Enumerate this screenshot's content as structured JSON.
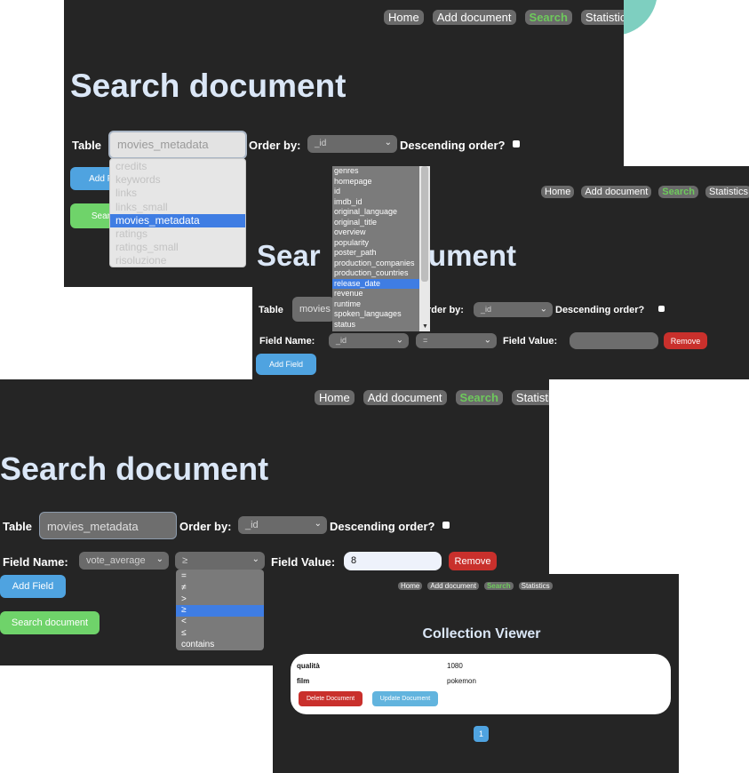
{
  "nav": {
    "home": "Home",
    "add": "Add document",
    "search": "Search",
    "stats": "Statistics"
  },
  "search": {
    "title": "Search document",
    "table_label": "Table",
    "order_label": "Order by:",
    "desc_label": "Descending order?",
    "field_name_label": "Field Name:",
    "field_value_label": "Field Value:",
    "add_field": "Add Field",
    "search_btn": "Search document",
    "remove": "Remove"
  },
  "p1": {
    "table_value": "movies_metadata",
    "order_value": "_id",
    "add_field_visible": "Add Fi",
    "search_visible": "Searc",
    "tables": [
      "credits",
      "keywords",
      "links",
      "links_small",
      "movies_metadata",
      "ratings",
      "ratings_small",
      "risoluzione"
    ]
  },
  "p2": {
    "table_visible": "movies",
    "order_visible": "rder by:",
    "title_left": "Sear",
    "title_right": "ument",
    "order_value": "_id",
    "field_value": "_id",
    "operator_value": "=",
    "fields": [
      "genres",
      "homepage",
      "id",
      "imdb_id",
      "original_language",
      "original_title",
      "overview",
      "popularity",
      "poster_path",
      "production_companies",
      "production_countries",
      "release_date",
      "revenue",
      "runtime",
      "spoken_languages",
      "status"
    ]
  },
  "p3": {
    "table_value": "movies_metadata",
    "order_value": "_id",
    "field_value": "vote_average",
    "operator_value": "≥",
    "value": "8",
    "operators": [
      "=",
      "≠",
      ">",
      "≥",
      "<",
      "≤",
      "contains"
    ]
  },
  "viewer": {
    "title": "Collection Viewer",
    "rows": [
      {
        "key": "qualità",
        "value": "1080"
      },
      {
        "key": "film",
        "value": "pokemon"
      }
    ],
    "delete": "Delete Document",
    "update": "Update Document",
    "page": "1"
  },
  "colors": {
    "accent_green": "#6ec95c",
    "blue": "#4fa3e0",
    "red": "#c9302c",
    "panel": "#252525",
    "title": "#dbe7f7"
  }
}
